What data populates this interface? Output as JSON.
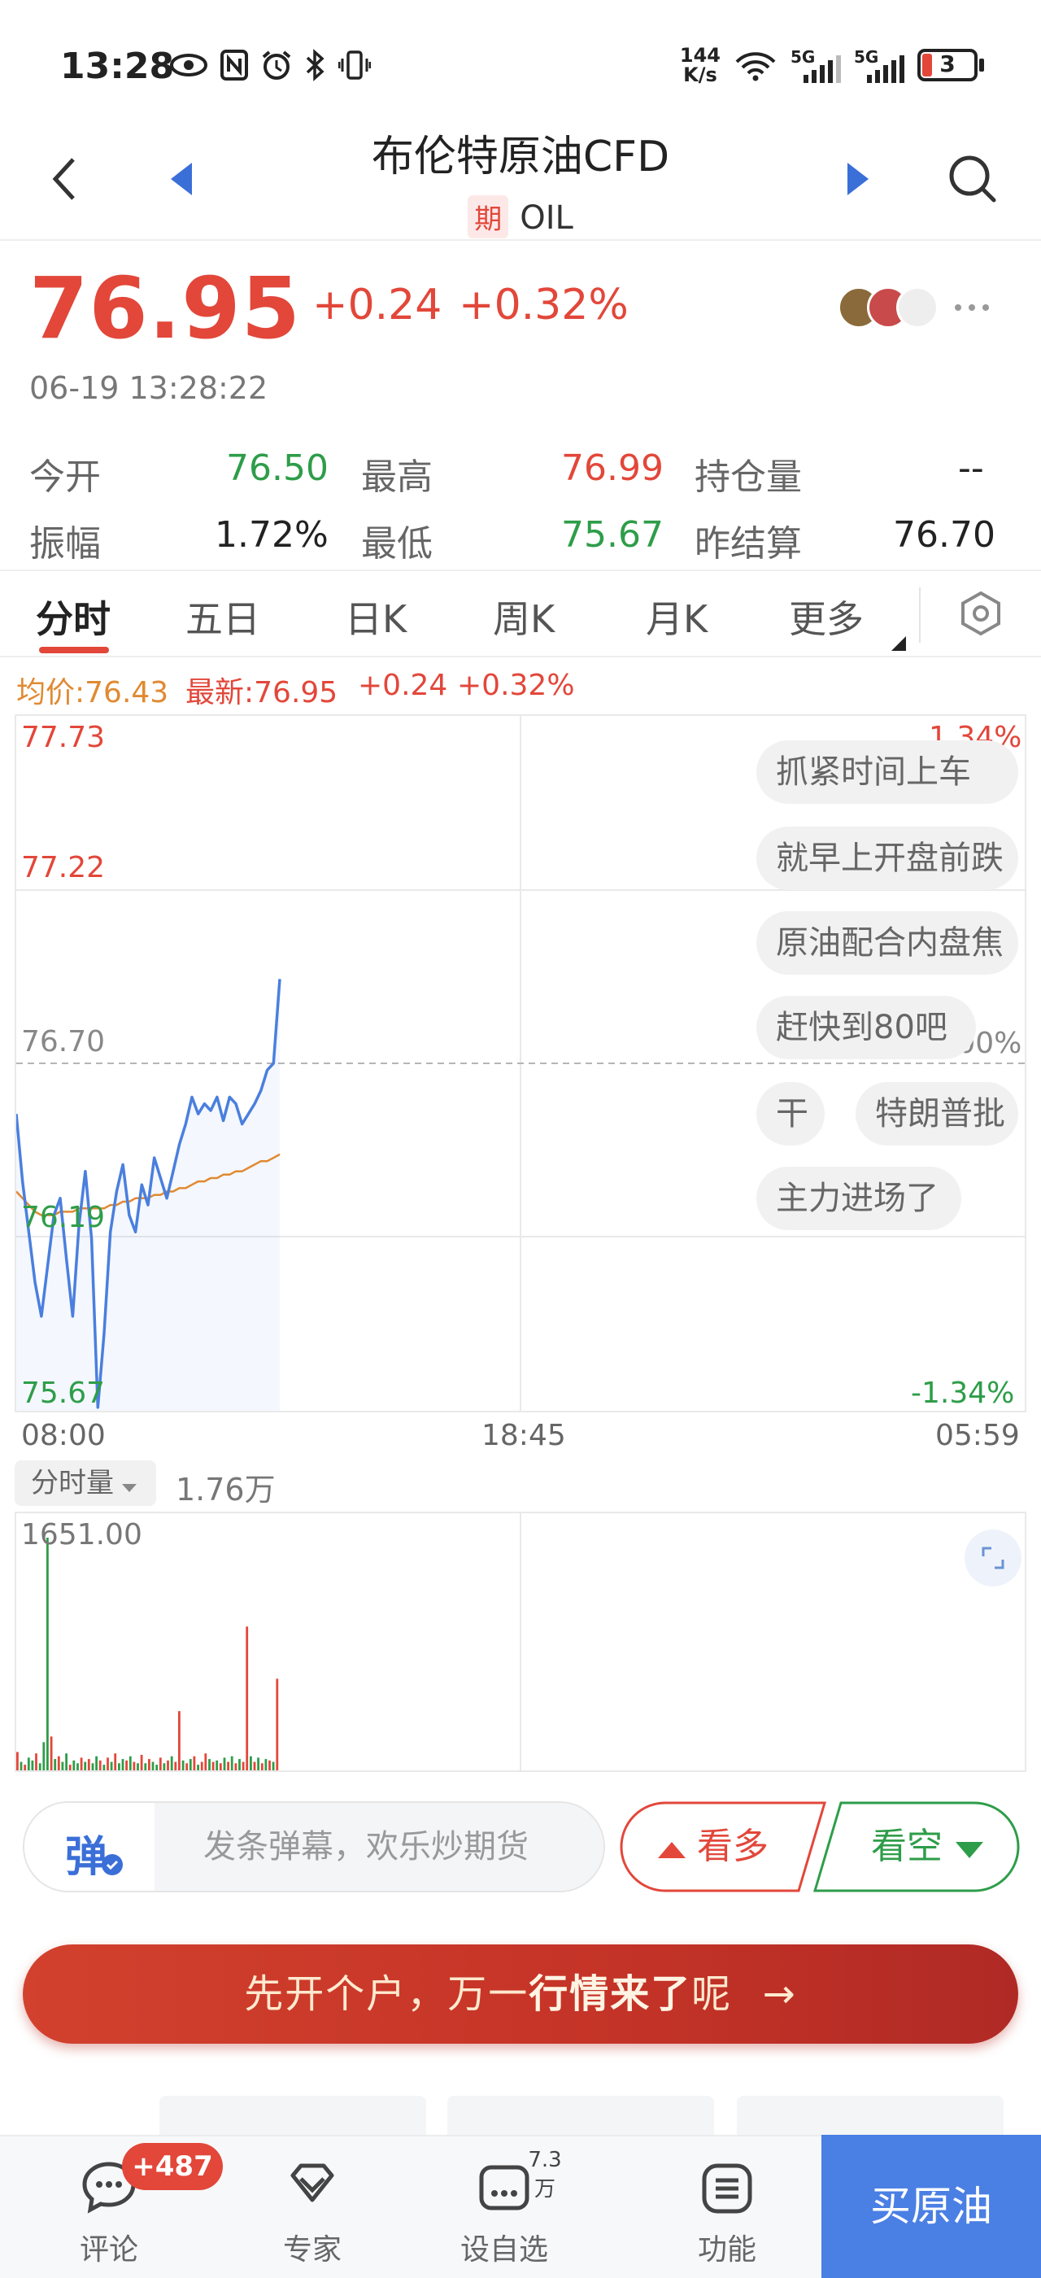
{
  "status_bar": {
    "time": "13:28",
    "net_speed_top": "144",
    "net_speed_bottom": "K/s",
    "network_1": "5G",
    "network_2": "5G",
    "battery": "3"
  },
  "header": {
    "title": "布伦特原油CFD",
    "tag": "期",
    "code": "OIL"
  },
  "quote": {
    "price": "76.95",
    "change": "+0.24",
    "change_pct": "+0.32%",
    "datetime": "06-19 13:28:22",
    "rows": [
      [
        {
          "label": "今开",
          "value": "76.50"
        },
        {
          "label": "最高",
          "value": "76.99"
        },
        {
          "label": "持仓量",
          "value": "--"
        }
      ],
      [
        {
          "label": "振幅",
          "value": "1.72%"
        },
        {
          "label": "最低",
          "value": "75.67"
        },
        {
          "label": "昨结算",
          "value": "76.70"
        }
      ]
    ]
  },
  "tabs": [
    "分时",
    "五日",
    "日K",
    "周K",
    "月K",
    "更多"
  ],
  "legend": {
    "avg": "均价:76.43",
    "latest": "最新:76.95",
    "change": "+0.24",
    "change_pct": "+0.32%"
  },
  "chart_labels": {
    "y_top": "77.73",
    "y_2": "77.22",
    "y_mid": "76.70",
    "y_4": "76.19",
    "y_bottom": "75.67",
    "pct_top": "1.34%",
    "pct_mid": "0.00%",
    "pct_bottom": "-1.34%",
    "x_start": "08:00",
    "x_mid": "18:45",
    "x_end": "05:59"
  },
  "danmaku": [
    "抓紧时间上车",
    "就早上开盘前跌",
    "原油配合内盘焦",
    "赶快到80吧",
    "干",
    "特朗普批",
    "主力进场了"
  ],
  "volume": {
    "selector": "分时量",
    "total": "1.76万",
    "max": "1651.00"
  },
  "danmu_bar": {
    "icon_text": "弹",
    "placeholder": "发条弹幕，欢乐炒期货",
    "bull": "看多",
    "bear": "看空"
  },
  "promo": {
    "text_a": "先开个户，万一",
    "text_b": "行情来了",
    "text_c": "呢",
    "arrow": "→"
  },
  "bottom_nav": {
    "comment": "评论",
    "comment_badge": "+487",
    "expert": "专家",
    "watchlist": "设自选",
    "watch_count": "7.3万",
    "features": "功能",
    "buy": "买原油"
  },
  "colors": {
    "up": "#e2473a",
    "down": "#2e9d49",
    "price_line": "#4a7fde",
    "avg_line": "#e08a32",
    "accent": "#4a7fe4"
  },
  "chart_data": {
    "type": "line",
    "ylim": [
      75.67,
      77.73
    ],
    "series": [
      {
        "name": "最新",
        "values": [
          76.55,
          76.35,
          76.2,
          76.05,
          75.95,
          76.1,
          76.25,
          76.3,
          76.12,
          75.95,
          76.22,
          76.38,
          76.18,
          75.68,
          75.9,
          76.2,
          76.32,
          76.4,
          76.25,
          76.2,
          76.34,
          76.28,
          76.42,
          76.36,
          76.3,
          76.38,
          76.46,
          76.52,
          76.6,
          76.55,
          76.58,
          76.56,
          76.6,
          76.53,
          76.6,
          76.58,
          76.52,
          76.55,
          76.58,
          76.62,
          76.68,
          76.7,
          76.95
        ]
      },
      {
        "name": "均价",
        "values": [
          76.32,
          76.3,
          76.28,
          76.26,
          76.25,
          76.25,
          76.25,
          76.26,
          76.26,
          76.26,
          76.27,
          76.27,
          76.27,
          76.27,
          76.27,
          76.28,
          76.28,
          76.29,
          76.29,
          76.3,
          76.3,
          76.3,
          76.31,
          76.31,
          76.32,
          76.32,
          76.33,
          76.33,
          76.34,
          76.35,
          76.35,
          76.36,
          76.36,
          76.37,
          76.37,
          76.38,
          76.38,
          76.39,
          76.4,
          76.41,
          76.41,
          76.42,
          76.43
        ]
      }
    ],
    "volume_ylim": [
      0,
      1651
    ],
    "volume_bars": [
      {
        "v": 130,
        "c": "r"
      },
      {
        "v": 60,
        "c": "g"
      },
      {
        "v": 40,
        "c": "r"
      },
      {
        "v": 90,
        "c": "g"
      },
      {
        "v": 70,
        "c": "g"
      },
      {
        "v": 120,
        "c": "r"
      },
      {
        "v": 50,
        "c": "g"
      },
      {
        "v": 200,
        "c": "g"
      },
      {
        "v": 1651,
        "c": "g"
      },
      {
        "v": 240,
        "c": "r"
      },
      {
        "v": 80,
        "c": "g"
      },
      {
        "v": 100,
        "c": "r"
      },
      {
        "v": 60,
        "c": "g"
      },
      {
        "v": 120,
        "c": "g"
      },
      {
        "v": 40,
        "c": "r"
      },
      {
        "v": 70,
        "c": "g"
      },
      {
        "v": 50,
        "c": "g"
      },
      {
        "v": 90,
        "c": "r"
      },
      {
        "v": 60,
        "c": "g"
      },
      {
        "v": 80,
        "c": "r"
      },
      {
        "v": 50,
        "c": "g"
      },
      {
        "v": 100,
        "c": "g"
      },
      {
        "v": 70,
        "c": "r"
      },
      {
        "v": 40,
        "c": "g"
      },
      {
        "v": 90,
        "c": "r"
      },
      {
        "v": 60,
        "c": "g"
      },
      {
        "v": 120,
        "c": "r"
      },
      {
        "v": 50,
        "c": "g"
      },
      {
        "v": 80,
        "c": "g"
      },
      {
        "v": 70,
        "c": "r"
      },
      {
        "v": 100,
        "c": "g"
      },
      {
        "v": 60,
        "c": "r"
      },
      {
        "v": 50,
        "c": "g"
      },
      {
        "v": 110,
        "c": "r"
      },
      {
        "v": 50,
        "c": "g"
      },
      {
        "v": 80,
        "c": "r"
      },
      {
        "v": 60,
        "c": "g"
      },
      {
        "v": 40,
        "c": "g"
      },
      {
        "v": 90,
        "c": "r"
      },
      {
        "v": 50,
        "c": "g"
      },
      {
        "v": 70,
        "c": "r"
      },
      {
        "v": 100,
        "c": "g"
      },
      {
        "v": 60,
        "c": "r"
      },
      {
        "v": 420,
        "c": "r"
      },
      {
        "v": 70,
        "c": "g"
      },
      {
        "v": 50,
        "c": "r"
      },
      {
        "v": 80,
        "c": "g"
      },
      {
        "v": 100,
        "c": "r"
      },
      {
        "v": 40,
        "c": "g"
      },
      {
        "v": 60,
        "c": "r"
      },
      {
        "v": 120,
        "c": "r"
      },
      {
        "v": 80,
        "c": "g"
      },
      {
        "v": 60,
        "c": "r"
      },
      {
        "v": 70,
        "c": "g"
      },
      {
        "v": 50,
        "c": "r"
      },
      {
        "v": 90,
        "c": "g"
      },
      {
        "v": 60,
        "c": "r"
      },
      {
        "v": 100,
        "c": "g"
      },
      {
        "v": 50,
        "c": "r"
      },
      {
        "v": 80,
        "c": "g"
      },
      {
        "v": 60,
        "c": "r"
      },
      {
        "v": 1020,
        "c": "r"
      },
      {
        "v": 100,
        "c": "g"
      },
      {
        "v": 60,
        "c": "r"
      },
      {
        "v": 90,
        "c": "g"
      },
      {
        "v": 50,
        "c": "r"
      },
      {
        "v": 80,
        "c": "g"
      },
      {
        "v": 70,
        "c": "r"
      },
      {
        "v": 60,
        "c": "g"
      },
      {
        "v": 650,
        "c": "r"
      }
    ]
  }
}
